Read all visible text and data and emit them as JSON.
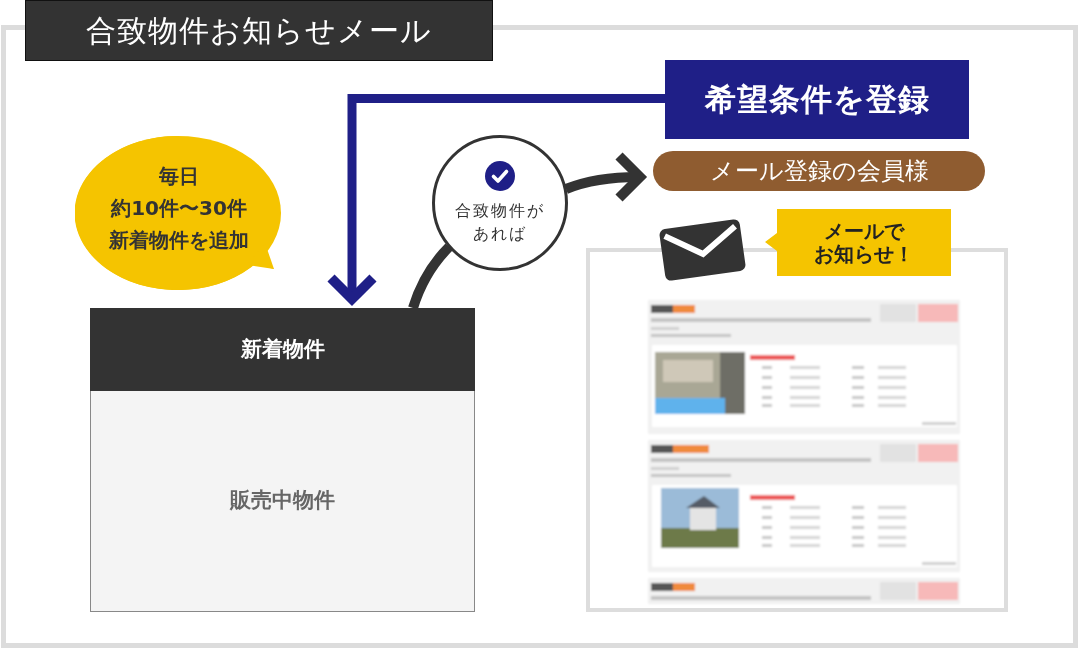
{
  "title": "合致物件お知らせメール",
  "registration": {
    "label": "希望条件を登録"
  },
  "daily_bubble": {
    "lines": [
      "毎日",
      "約10件〜30件",
      "新着物件を追加"
    ]
  },
  "condition": {
    "lines": [
      "合致物件が",
      "あれば"
    ]
  },
  "recipients": {
    "label": "メール登録の会員様"
  },
  "notice": {
    "lines": [
      "メールで",
      "お知らせ！"
    ]
  },
  "listing_box": {
    "header": "新着物件",
    "body": "販売中物件"
  }
}
